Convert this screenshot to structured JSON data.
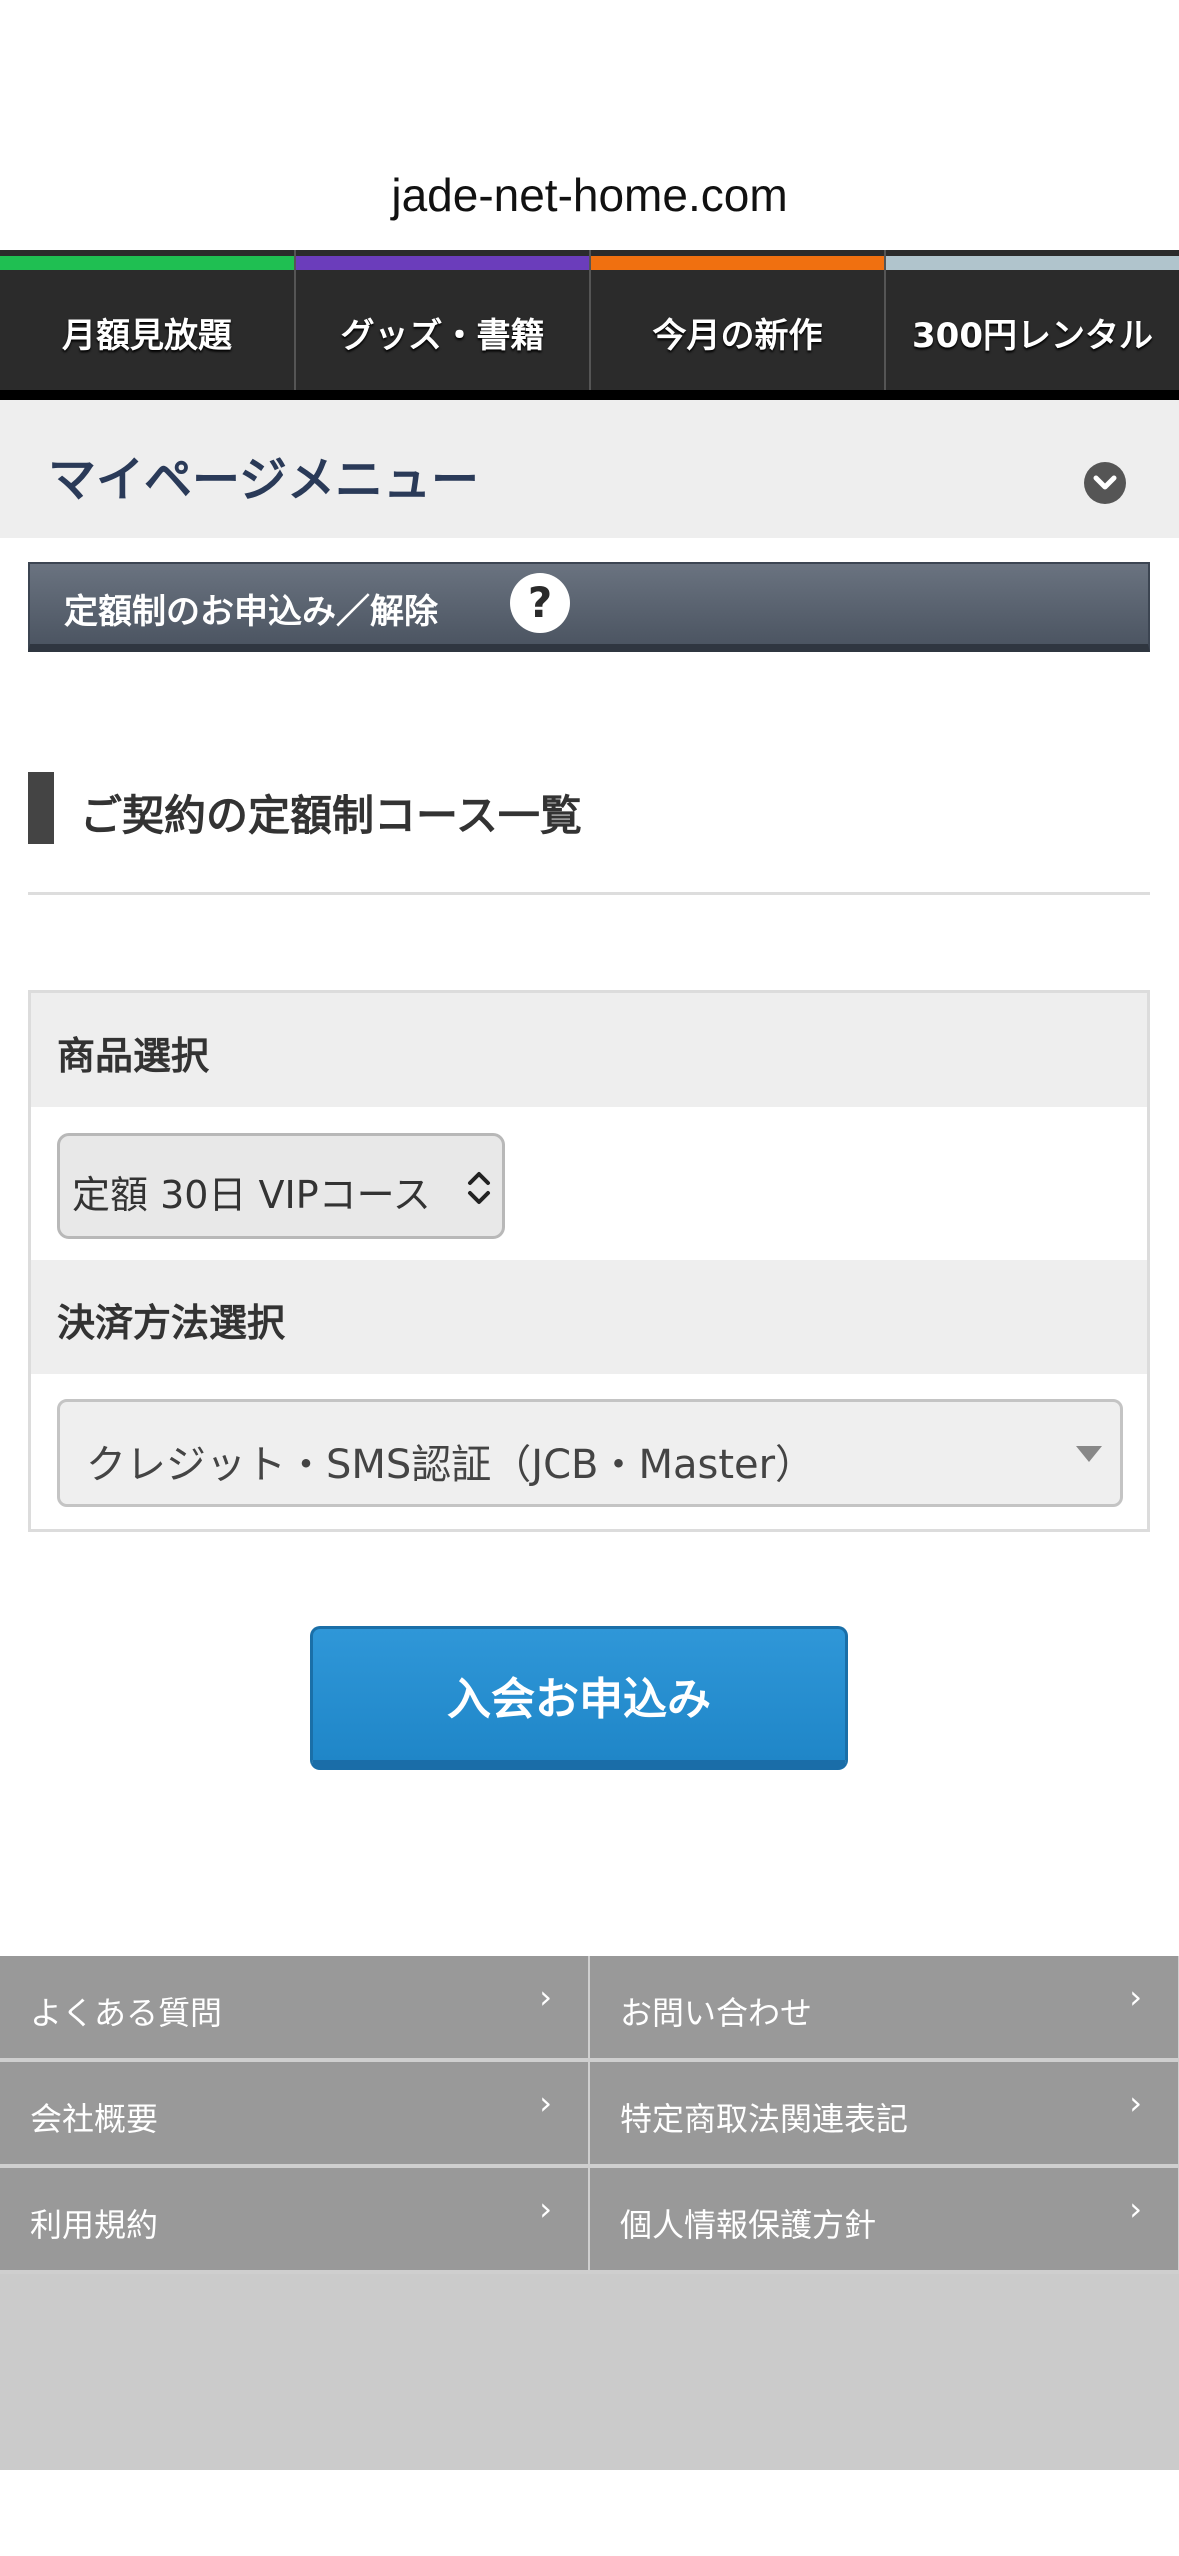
{
  "browser": {
    "url": "jade-net-home.com"
  },
  "nav": {
    "tabs": [
      {
        "label": "月額見放題",
        "stripe": "#1fbf52"
      },
      {
        "label": "グッズ・書籍",
        "stripe": "#6b3dbb"
      },
      {
        "label": "今月の新作",
        "stripe": "#f07010"
      },
      {
        "label": "300円レンタル",
        "stripe": "#b0c4cc"
      }
    ]
  },
  "mypage": {
    "title": "マイページメニュー",
    "icon": "chevron-down-icon"
  },
  "section": {
    "label": "定額制のお申込み／解除",
    "help": "?"
  },
  "heading": {
    "text": "ご契約の定額制コース一覧"
  },
  "form": {
    "product_label": "商品選択",
    "product_value": "定額 30日 VIPコース",
    "payment_label": "決済方法選択",
    "payment_value": "クレジット・SMS認証（JCB・Master）"
  },
  "submit": {
    "label": "入会お申込み",
    "color": "#2b92d4"
  },
  "footer": {
    "links": [
      {
        "label": "よくある質問"
      },
      {
        "label": "お問い合わせ"
      },
      {
        "label": "会社概要"
      },
      {
        "label": "特定商取法関連表記"
      },
      {
        "label": "利用規約"
      },
      {
        "label": "個人情報保護方針"
      }
    ],
    "chevron": "›"
  }
}
